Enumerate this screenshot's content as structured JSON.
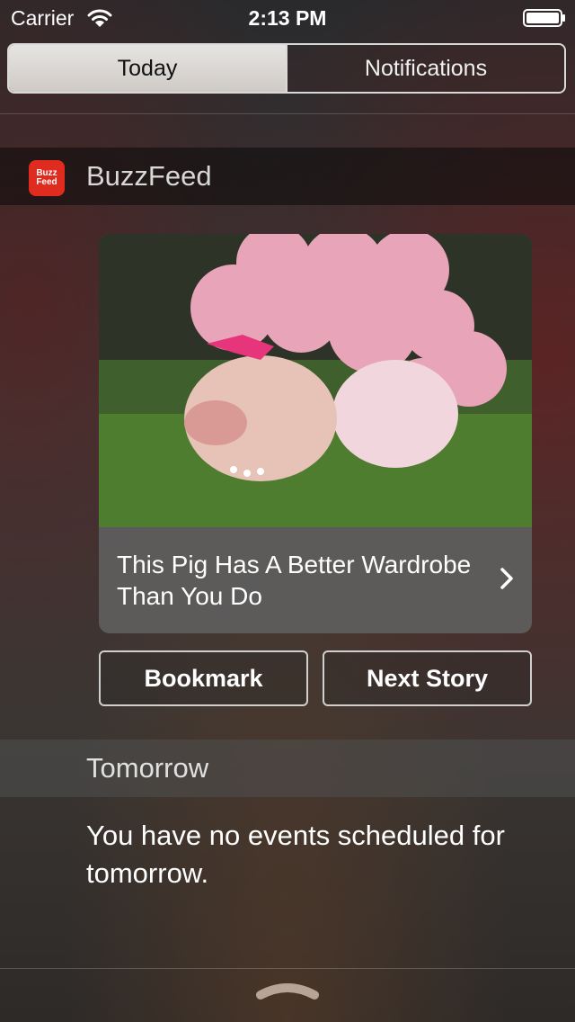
{
  "status_bar": {
    "carrier": "Carrier",
    "time": "2:13 PM",
    "icons": [
      "wifi-icon",
      "battery-icon"
    ]
  },
  "tabs": [
    {
      "label": "Today",
      "selected": true
    },
    {
      "label": "Notifications",
      "selected": false
    }
  ],
  "widget": {
    "app_name": "BuzzFeed",
    "app_icon_text": [
      "Buzz",
      "Feed"
    ],
    "brand_color": "#e02b1f",
    "story": {
      "image": "pig-in-dress-with-pink-balloons",
      "caption": "This Pig Has A Better Wardrobe Than You Do"
    },
    "bookmark_label": "Bookmark",
    "next_story_label": "Next Story"
  },
  "tomorrow": {
    "title": "Tomorrow",
    "message": "You have no events scheduled for tomorrow."
  }
}
